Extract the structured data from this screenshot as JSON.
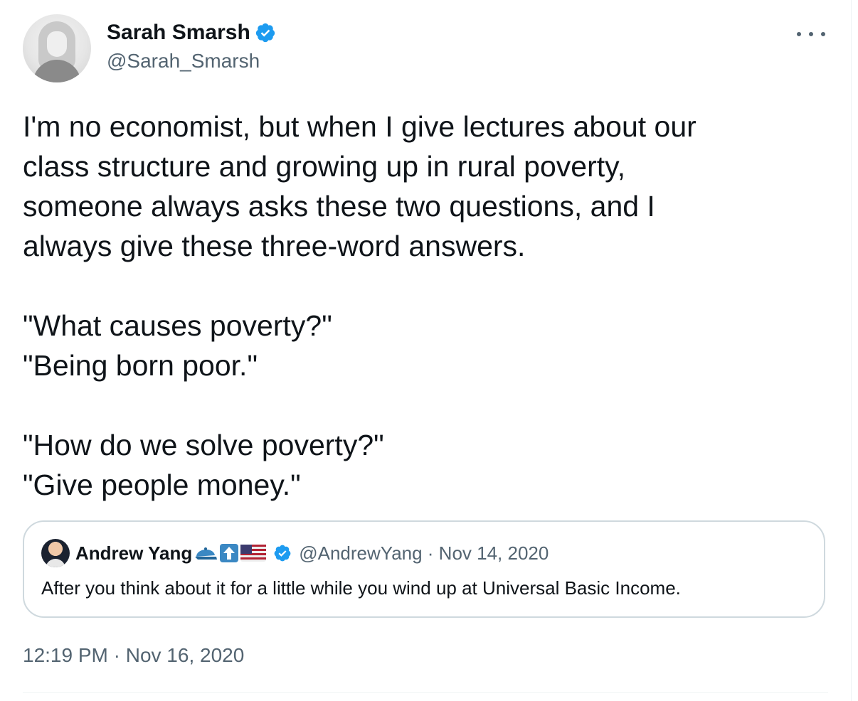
{
  "author": {
    "display_name": "Sarah Smarsh",
    "handle": "@Sarah_Smarsh",
    "verified": true,
    "avatar_icon": "profile-photo"
  },
  "tweet": {
    "text": "I'm no economist, but when I give lectures about our\nclass structure and growing up in rural poverty,\nsomeone always asks these two questions, and I\nalways give these three-word answers.\n\n\"What causes poverty?\"\n\"Being born poor.\"\n\n\"How do we solve poverty?\"\n\"Give people money.\"",
    "timestamp": "12:19 PM · Nov 16, 2020"
  },
  "quoted_tweet": {
    "display_name": "Andrew Yang",
    "name_emojis": [
      "blue-cap-emoji",
      "up-arrow-emoji",
      "us-flag-emoji"
    ],
    "verified": true,
    "handle_date": "@AndrewYang · Nov 14, 2020",
    "text": "After you think about it for a little while you wind up at Universal Basic Income."
  },
  "colors": {
    "text_primary": "#0f1419",
    "text_secondary": "#536471",
    "verified_blue": "#1d9bf0",
    "border": "#cfd9de"
  }
}
